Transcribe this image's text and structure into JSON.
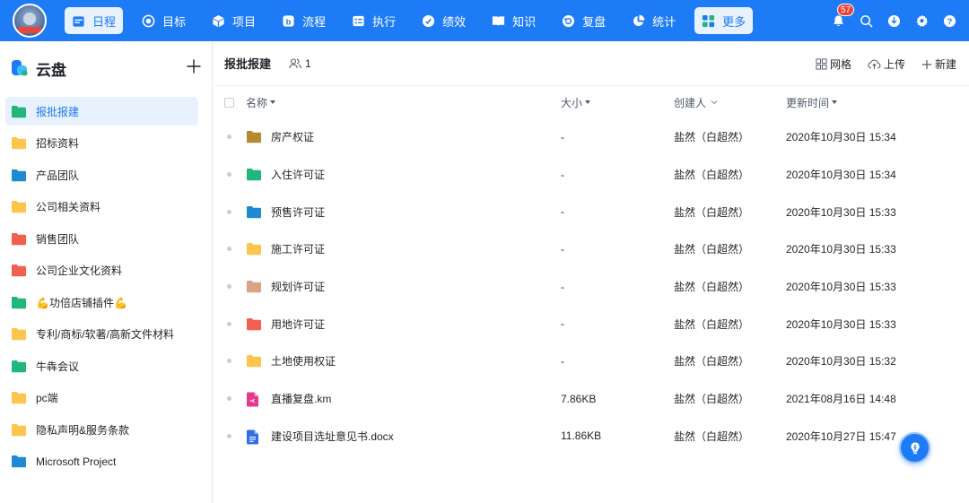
{
  "topnav": {
    "items": [
      {
        "label": "日程",
        "icon": "calendar-icon",
        "active": true
      },
      {
        "label": "目标",
        "icon": "target-icon",
        "active": false
      },
      {
        "label": "项目",
        "icon": "cube-icon",
        "active": false
      },
      {
        "label": "流程",
        "icon": "workflow-icon",
        "active": false
      },
      {
        "label": "执行",
        "icon": "checklist-icon",
        "active": false
      },
      {
        "label": "绩效",
        "icon": "performance-icon",
        "active": false
      },
      {
        "label": "知识",
        "icon": "book-icon",
        "active": false
      },
      {
        "label": "复盘",
        "icon": "review-icon",
        "active": false
      },
      {
        "label": "统计",
        "icon": "pie-chart-icon",
        "active": false
      },
      {
        "label": "更多",
        "icon": "apps-grid-icon",
        "active": true
      }
    ],
    "notification_count": "57"
  },
  "sidebar": {
    "title": "云盘",
    "items": [
      {
        "label": "报批报建",
        "color": "#21b67a",
        "active": true
      },
      {
        "label": "招标资料",
        "color": "#fdc54e",
        "active": false
      },
      {
        "label": "产品团队",
        "color": "#1e8ad3",
        "active": false
      },
      {
        "label": "公司相关资料",
        "color": "#fdc54e",
        "active": false
      },
      {
        "label": "销售团队",
        "color": "#f35f4f",
        "active": false
      },
      {
        "label": "公司企业文化资料",
        "color": "#f35f4f",
        "active": false
      },
      {
        "label": "💪功倍店铺插件💪",
        "color": "#21b67a",
        "active": false
      },
      {
        "label": "专利/商标/软著/高新文件材料",
        "color": "#fdc54e",
        "active": false
      },
      {
        "label": "牛犇会议",
        "color": "#21b67a",
        "active": false
      },
      {
        "label": "pc端",
        "color": "#fdc54e",
        "active": false
      },
      {
        "label": "隐私声明&服务条款",
        "color": "#fdc54e",
        "active": false
      },
      {
        "label": "Microsoft Project",
        "color": "#1e8ad3",
        "active": false
      }
    ]
  },
  "main": {
    "title": "报批报建",
    "member_count": "1",
    "actions": {
      "grid": "网格",
      "upload": "上传",
      "new": "新建"
    },
    "columns": {
      "name": "名称",
      "size": "大小",
      "creator": "创建人",
      "time": "更新时间"
    },
    "rows": [
      {
        "name": "房产权证",
        "type": "folder",
        "color": "#b5892c",
        "size": "-",
        "creator": "盐然（白超然）",
        "time": "2020年10月30日 15:34"
      },
      {
        "name": "入住许可证",
        "type": "folder",
        "color": "#21b67a",
        "size": "-",
        "creator": "盐然（白超然）",
        "time": "2020年10月30日 15:34"
      },
      {
        "name": "预售许可证",
        "type": "folder",
        "color": "#1e8ad3",
        "size": "-",
        "creator": "盐然（白超然）",
        "time": "2020年10月30日 15:33"
      },
      {
        "name": "施工许可证",
        "type": "folder",
        "color": "#fdc54e",
        "size": "-",
        "creator": "盐然（白超然）",
        "time": "2020年10月30日 15:33"
      },
      {
        "name": "规划许可证",
        "type": "folder",
        "color": "#d9a385",
        "size": "-",
        "creator": "盐然（白超然）",
        "time": "2020年10月30日 15:33"
      },
      {
        "name": "用地许可证",
        "type": "folder",
        "color": "#f35f4f",
        "size": "-",
        "creator": "盐然（白超然）",
        "time": "2020年10月30日 15:33"
      },
      {
        "name": "土地使用权证",
        "type": "folder",
        "color": "#fdc54e",
        "size": "-",
        "creator": "盐然（白超然）",
        "time": "2020年10月30日 15:32"
      },
      {
        "name": "直播复盘.km",
        "type": "km",
        "color": "#e5398e",
        "size": "7.86KB",
        "creator": "盐然（白超然）",
        "time": "2021年08月16日 14:48"
      },
      {
        "name": "建设项目选址意见书.docx",
        "type": "docx",
        "color": "#2f6ee8",
        "size": "11.86KB",
        "creator": "盐然（白超然）",
        "time": "2020年10月27日 15:47"
      }
    ]
  },
  "colors": {
    "brand": "#1e7bf6",
    "active_bg": "#e8f1fe"
  }
}
